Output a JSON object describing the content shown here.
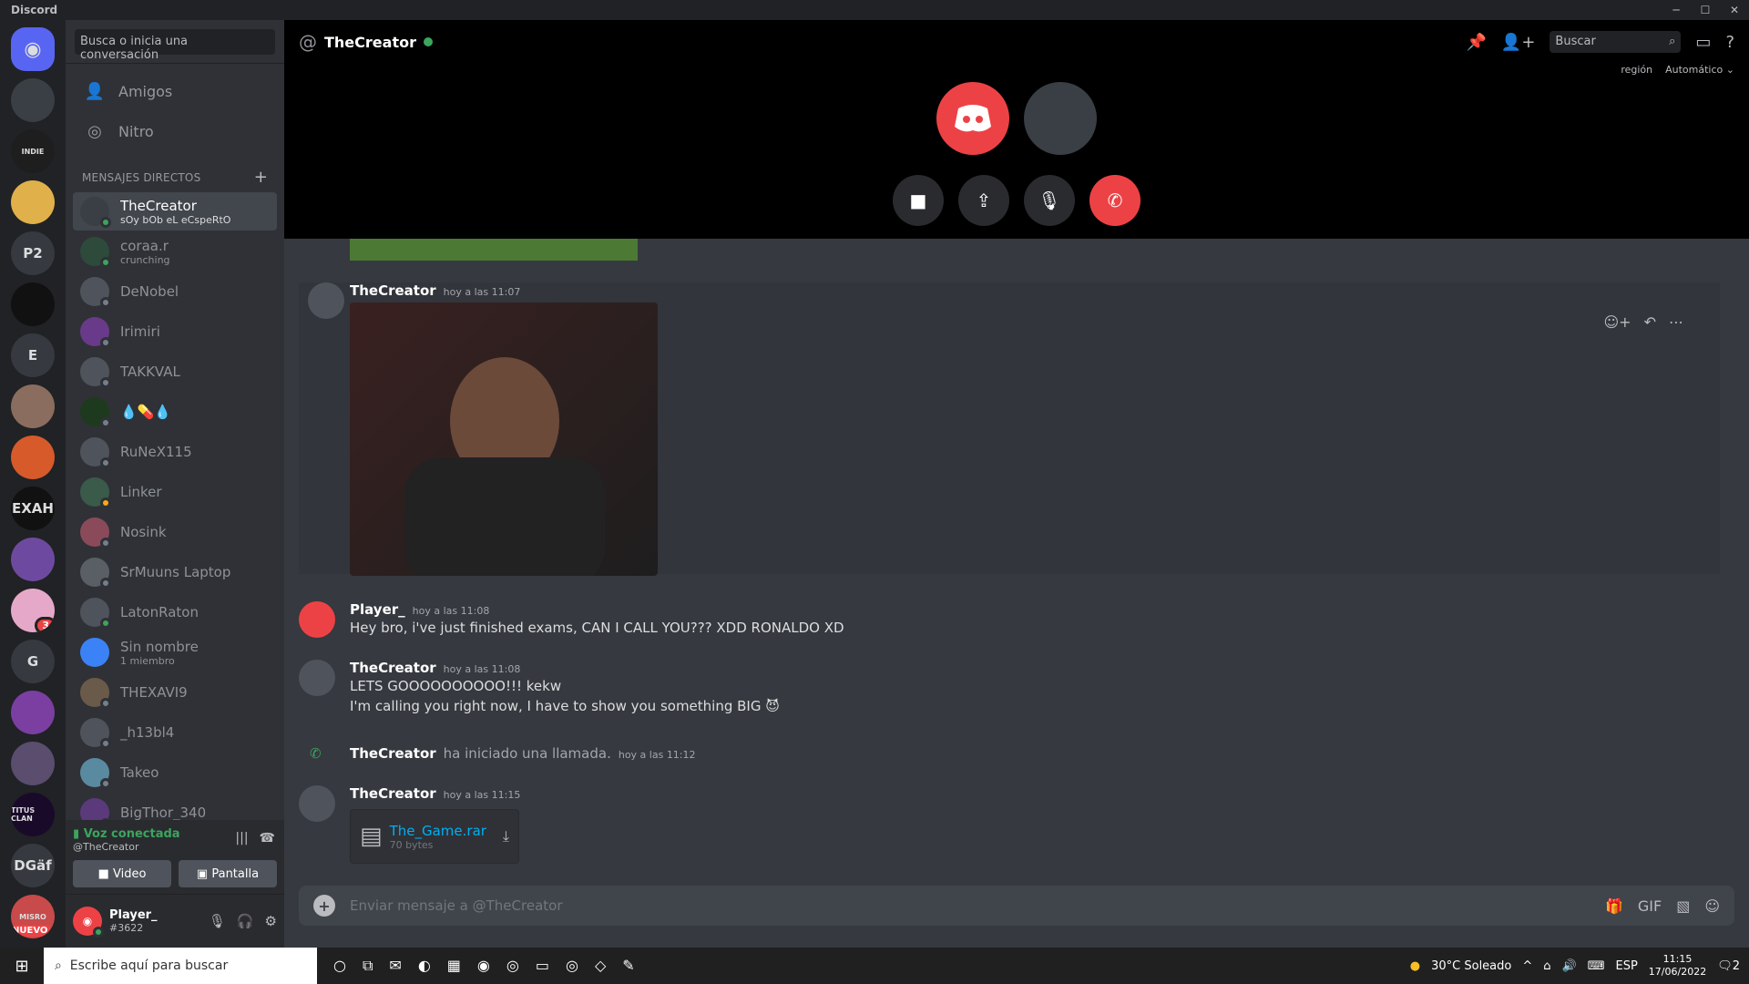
{
  "titlebar": {
    "brand": "Discord"
  },
  "guilds": [
    {
      "label": "",
      "type": "home"
    },
    {
      "label": ""
    },
    {
      "label": "INDIE"
    },
    {
      "label": ""
    },
    {
      "label": "P2"
    },
    {
      "label": ""
    },
    {
      "label": "E"
    },
    {
      "label": ""
    },
    {
      "label": ""
    },
    {
      "label": "EXAH"
    },
    {
      "label": ""
    },
    {
      "label": "",
      "badge": "3"
    },
    {
      "label": "G"
    },
    {
      "label": ""
    },
    {
      "label": ""
    },
    {
      "label": "TITUS CLAN"
    },
    {
      "label": "DGäf"
    },
    {
      "label": "MISRO",
      "nuevo": "NUEVO"
    }
  ],
  "sidebar": {
    "search_placeholder": "Busca o inicia una conversación",
    "friends": "Amigos",
    "nitro": "Nitro",
    "dm_header": "MENSAJES DIRECTOS",
    "dms": [
      {
        "name": "TheCreator",
        "sub": "sOy bOb eL eCspeRtO",
        "status": "on",
        "active": true
      },
      {
        "name": "coraa.r",
        "sub": "crunching",
        "status": "on"
      },
      {
        "name": "DeNobel",
        "sub": "",
        "status": "off"
      },
      {
        "name": "Irimiri",
        "sub": "",
        "status": "off"
      },
      {
        "name": "TAKKVAL",
        "sub": "",
        "status": "off"
      },
      {
        "name": "💧💊💧",
        "sub": "",
        "status": "off"
      },
      {
        "name": "RuNeX115",
        "sub": "",
        "status": "off"
      },
      {
        "name": "Linker",
        "sub": "",
        "status": "idle"
      },
      {
        "name": "Nosink",
        "sub": "",
        "status": "off"
      },
      {
        "name": "SrMuuns Laptop",
        "sub": "",
        "status": "off"
      },
      {
        "name": "LatonRaton",
        "sub": "",
        "status": "on"
      },
      {
        "name": "Sin nombre",
        "sub": "1 miembro",
        "status": ""
      },
      {
        "name": "THEXAVI9",
        "sub": "",
        "status": "off"
      },
      {
        "name": "_h13bl4",
        "sub": "",
        "status": "off"
      },
      {
        "name": "Takeo",
        "sub": "",
        "status": "off"
      },
      {
        "name": "BigThor_340",
        "sub": "",
        "status": "off"
      }
    ]
  },
  "voice": {
    "status": "Voz conectada",
    "where": "@TheCreator",
    "video": "Video",
    "screen": "Pantalla"
  },
  "user": {
    "name": "Player_",
    "tag": "#3622"
  },
  "call": {
    "title": "TheCreator",
    "search": "Buscar",
    "region_label": "región",
    "region_value": "Automático"
  },
  "messages": [
    {
      "author": "TheCreator",
      "time": "hoy a las 11:07"
    },
    {
      "author": "Player_",
      "time": "hoy a las 11:08",
      "lines": [
        "Hey bro, i've just finished exams, CAN I CALL YOU??? XDD RONALDO XD"
      ]
    },
    {
      "author": "TheCreator",
      "time": "hoy a las 11:08",
      "lines": [
        "LETS GOOOOOOOOOO!!! kekw",
        "I'm calling you right now, I have to show you something BIG 😈"
      ]
    },
    {
      "author": "TheCreator",
      "system": "ha iniciado una llamada.",
      "time": "hoy a las 11:12"
    },
    {
      "author": "TheCreator",
      "time": "hoy a las 11:15",
      "file": {
        "name": "The_Game.rar",
        "size": "70 bytes"
      }
    }
  ],
  "composer": {
    "placeholder": "Enviar mensaje a @TheCreator"
  },
  "taskbar": {
    "search": "Escribe aquí para buscar",
    "weather": "30°C  Soleado",
    "lang": "ESP",
    "time": "11:15",
    "date": "17/06/2022",
    "notif": "2"
  },
  "colors": {
    "blurple": "#5865f2",
    "green": "#3ba55d",
    "red": "#ed4245",
    "link": "#00aff4"
  }
}
